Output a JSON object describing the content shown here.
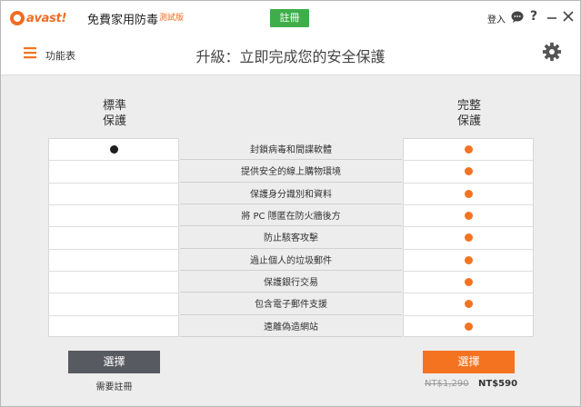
{
  "app": {
    "logo_text": "avast!",
    "product_name": "免費家用防毒",
    "trial_badge": "測試版",
    "register_label": "註冊",
    "login_label": "登入"
  },
  "header": {
    "menu_label": "功能表",
    "title": "升級：立即完成您的安全保護"
  },
  "columns": {
    "standard": {
      "line1": "標準",
      "line2": "保護",
      "button": "選擇",
      "note": "需要註冊"
    },
    "complete": {
      "line1": "完整",
      "line2": "保護",
      "button": "選擇",
      "old_price": "NT$1,290",
      "new_price": "NT$590"
    }
  },
  "features": [
    {
      "label": "封鎖病毒和間諜軟體",
      "standard": true,
      "complete": true
    },
    {
      "label": "提供安全的線上購物環境",
      "standard": false,
      "complete": true
    },
    {
      "label": "保護身分識別和資料",
      "standard": false,
      "complete": true
    },
    {
      "label": "將 PC 隱匿在防火牆後方",
      "standard": false,
      "complete": true
    },
    {
      "label": "防止駭客攻擊",
      "standard": false,
      "complete": true
    },
    {
      "label": "過止個人的垃圾郵件",
      "standard": false,
      "complete": true
    },
    {
      "label": "保護銀行交易",
      "standard": false,
      "complete": true
    },
    {
      "label": "包含電子郵件支援",
      "standard": false,
      "complete": true
    },
    {
      "label": "遠離偽造網站",
      "standard": false,
      "complete": true
    }
  ],
  "colors": {
    "accent": "#f47320",
    "register_green": "#3fae4a",
    "standard_button": "#585a61",
    "dot_standard": "#1f1f1f"
  },
  "icons": [
    "avast-logo-icon",
    "chat-icon",
    "help-icon",
    "minimize-icon",
    "close-icon",
    "hamburger-menu-icon",
    "gear-icon"
  ]
}
